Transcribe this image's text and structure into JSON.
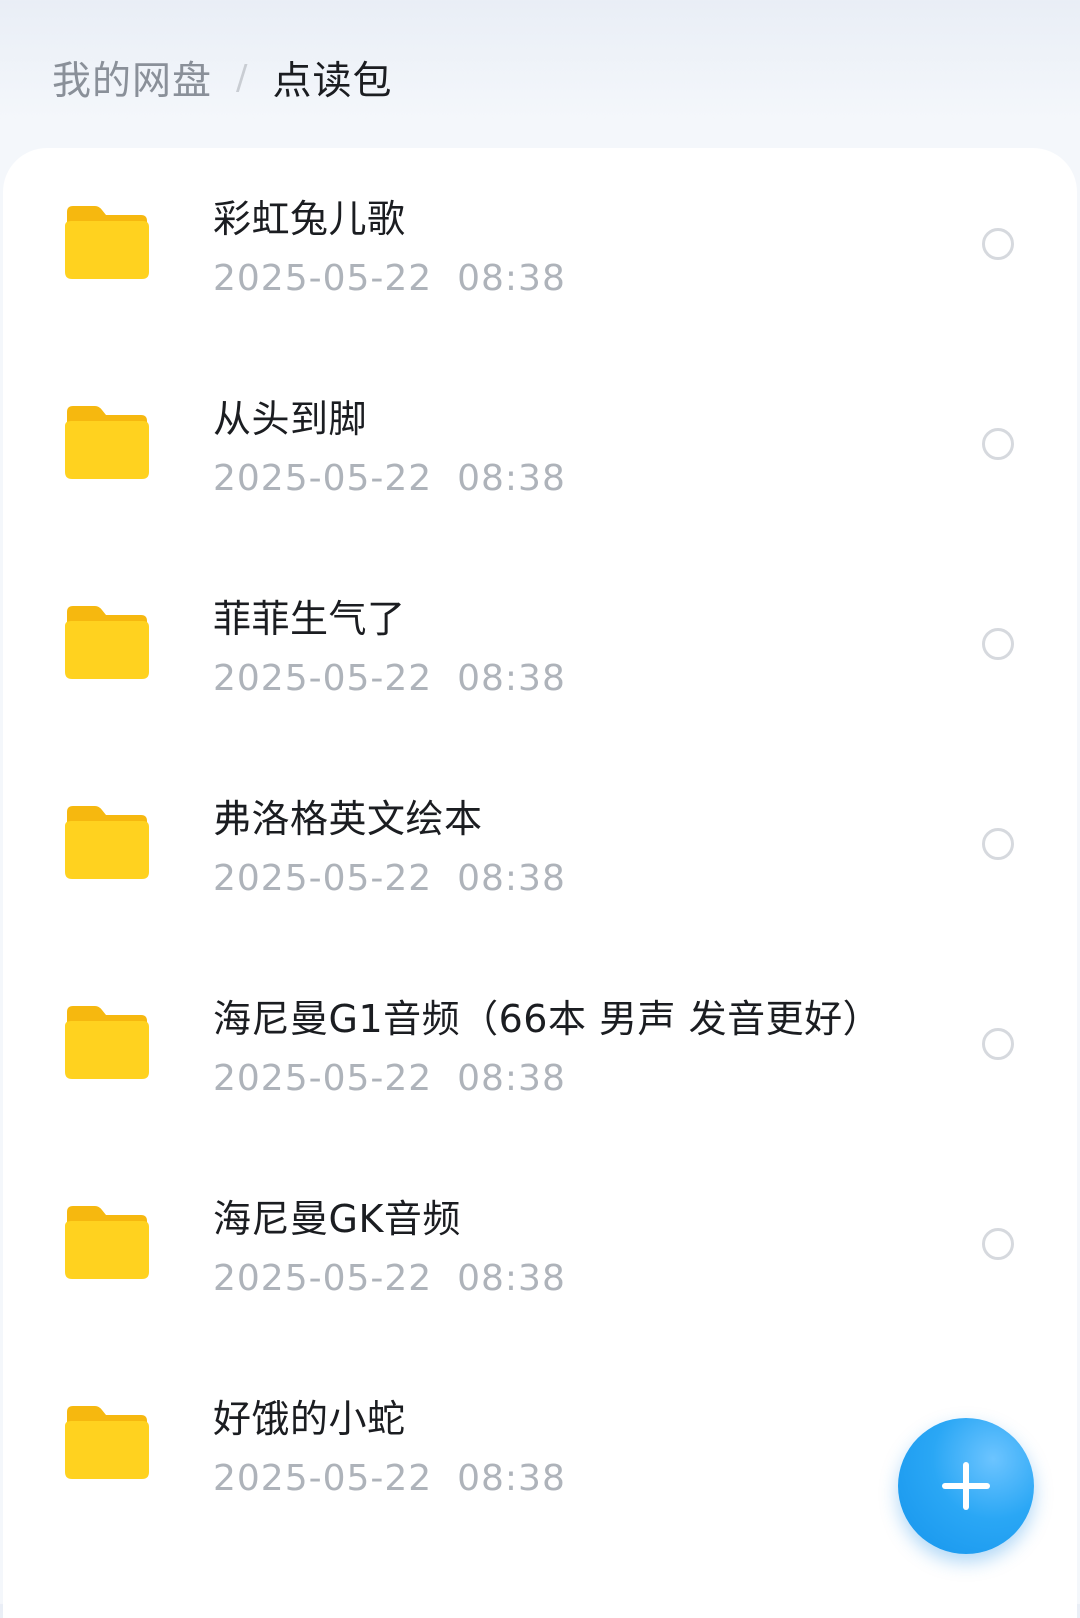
{
  "breadcrumb": {
    "root": "我的网盘",
    "separator": "/",
    "current": "点读包"
  },
  "folders": [
    {
      "name": "彩虹兔儿歌",
      "date": "2025-05-22  08:38",
      "icon": "folder-icon"
    },
    {
      "name": "从头到脚",
      "date": "2025-05-22  08:38",
      "icon": "folder-icon"
    },
    {
      "name": "菲菲生气了",
      "date": "2025-05-22  08:38",
      "icon": "folder-icon"
    },
    {
      "name": "弗洛格英文绘本",
      "date": "2025-05-22  08:38",
      "icon": "folder-icon"
    },
    {
      "name": "海尼曼G1音频（66本 男声 发音更好）",
      "date": "2025-05-22  08:38",
      "icon": "folder-icon"
    },
    {
      "name": "海尼曼GK音频",
      "date": "2025-05-22  08:38",
      "icon": "folder-icon"
    },
    {
      "name": "好饿的小蛇",
      "date": "2025-05-22  08:38",
      "icon": "folder-icon"
    }
  ],
  "fab": {
    "icon": "plus-icon"
  },
  "colors": {
    "folder": "#ffcc1a",
    "fab": "#2aa7f5",
    "text_primary": "#1b1d21",
    "text_secondary": "#aeb3ba"
  }
}
